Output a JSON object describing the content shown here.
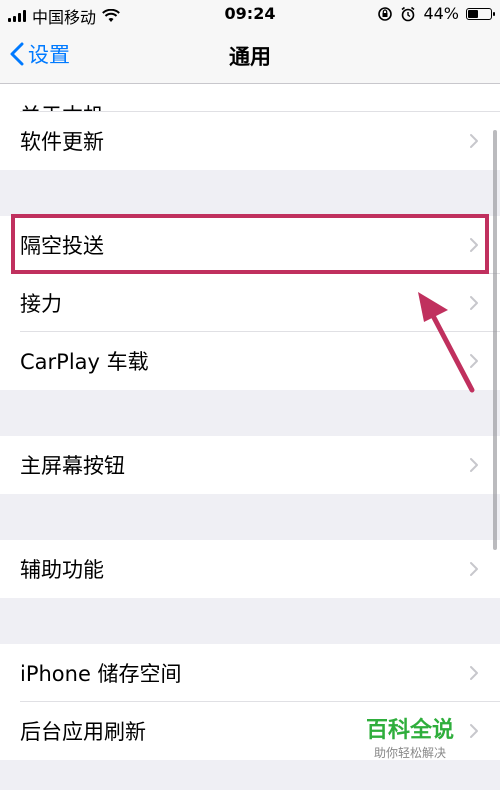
{
  "status": {
    "carrier": "中国移动",
    "time": "09:24",
    "battery": "44%",
    "battery_level": 0.44
  },
  "nav": {
    "back_label": "设置",
    "title": "通用"
  },
  "cells": {
    "partial": "关于本机",
    "software_update": "软件更新",
    "airdrop": "隔空投送",
    "handoff": "接力",
    "carplay": "CarPlay 车载",
    "home_button": "主屏幕按钮",
    "accessibility": "辅助功能",
    "iphone_storage": "iPhone 储存空间",
    "background_refresh": "后台应用刷新"
  },
  "watermark": {
    "brand": "百科全说",
    "slogan": "助你轻松解决"
  },
  "colors": {
    "accent": "#007aff",
    "highlight": "#c0305e",
    "watermark": "#2fae3c"
  }
}
